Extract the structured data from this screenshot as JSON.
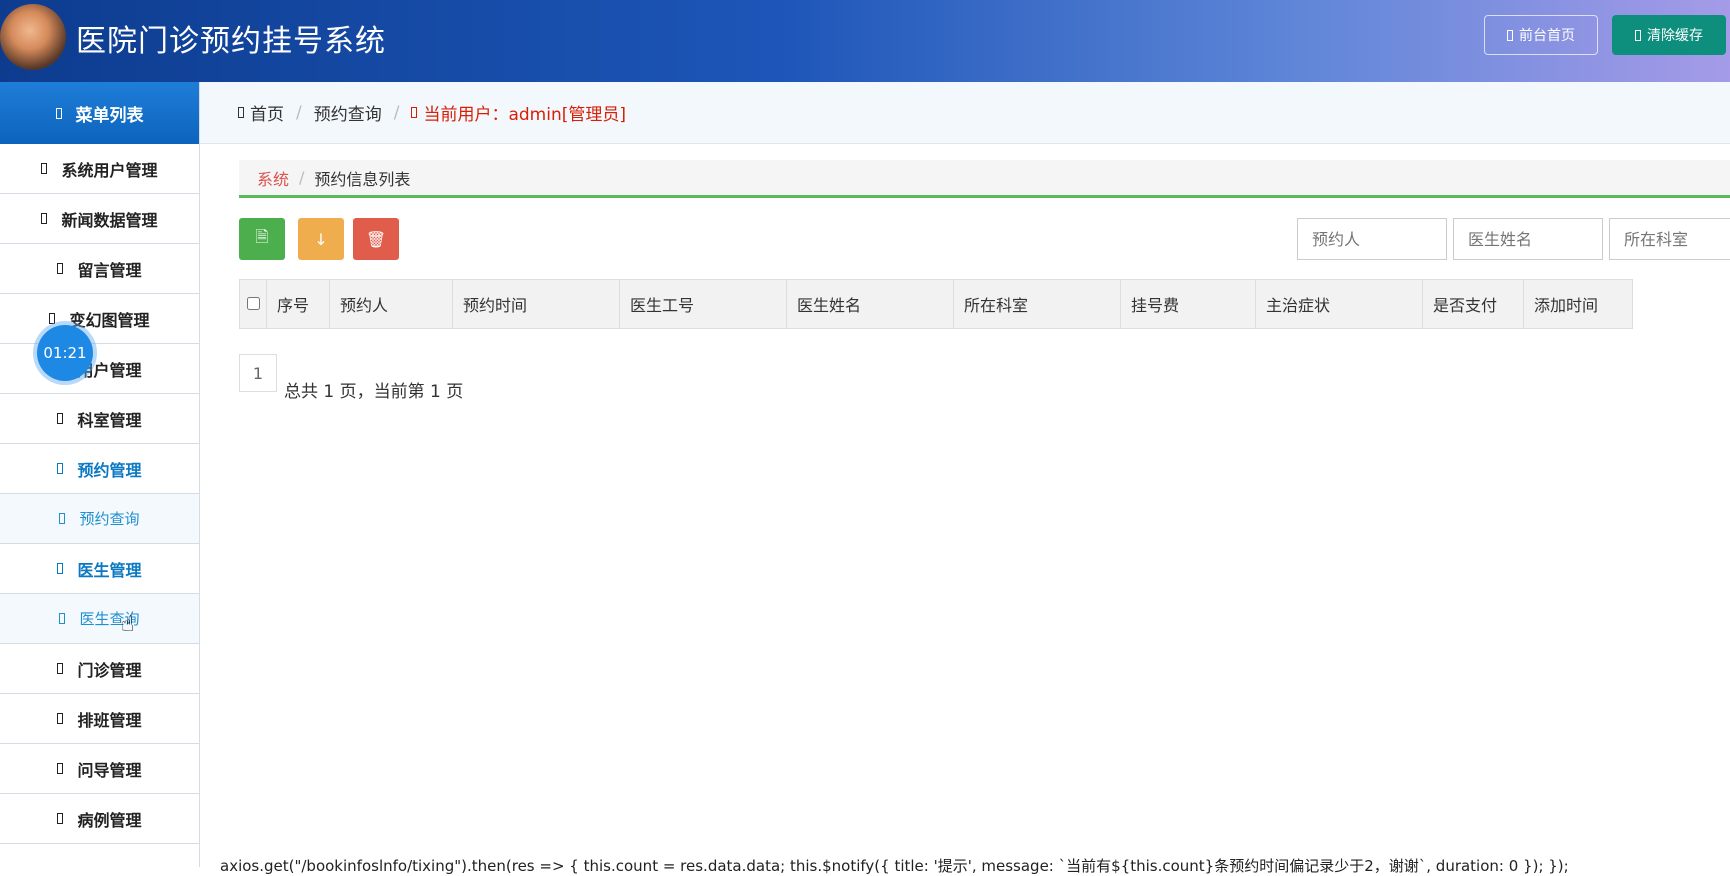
{
  "app": {
    "title": "医院门诊预约挂号系统"
  },
  "header_buttons": {
    "front": "前台首页",
    "clear": "清除缓存"
  },
  "sidebar": {
    "title": "菜单列表",
    "items": [
      {
        "label": "系统用户管理"
      },
      {
        "label": "新闻数据管理"
      },
      {
        "label": "留言管理"
      },
      {
        "label": "变幻图管理"
      },
      {
        "label": "用户管理"
      },
      {
        "label": "科室管理"
      },
      {
        "label": "预约管理"
      },
      {
        "label": "预约查询"
      },
      {
        "label": "医生管理"
      },
      {
        "label": "医生查询"
      },
      {
        "label": "门诊管理"
      },
      {
        "label": "排班管理"
      },
      {
        "label": "问导管理"
      },
      {
        "label": "病例管理"
      }
    ]
  },
  "timer": "01:21",
  "breadcrumb": {
    "home": "首页",
    "page": "预约查询",
    "user": "当前用户：admin[管理员]"
  },
  "sub_breadcrumb": {
    "root": "系统",
    "current": "预约信息列表"
  },
  "filters": {
    "booker": "预约人",
    "doctor_name": "医生姓名",
    "department": "所在科室"
  },
  "table": {
    "columns": [
      "序号",
      "预约人",
      "预约时间",
      "医生工号",
      "医生姓名",
      "所在科室",
      "挂号费",
      "主治症状",
      "是否支付",
      "添加时间"
    ],
    "rows": []
  },
  "pager": {
    "current": "1",
    "summary": "总共 1 页，当前第 1 页"
  },
  "code_text": "axios.get(\"/bookinfoslnfo/tixing\").then(res => { this.count = res.data.data; this.$notify({ title: '提示', message: `当前有${this.count}条预约时间偏记录少于2，谢谢`, duration: 0 }); });",
  "colors": {
    "accent": "#0b78c2",
    "header_start": "#0d3c8f",
    "clear_btn": "#0e8f7d",
    "excel_btn": "#4cae4c",
    "download_btn": "#f0ad4e",
    "delete_btn": "#e05d4c",
    "crumb_user": "#d81e06"
  }
}
